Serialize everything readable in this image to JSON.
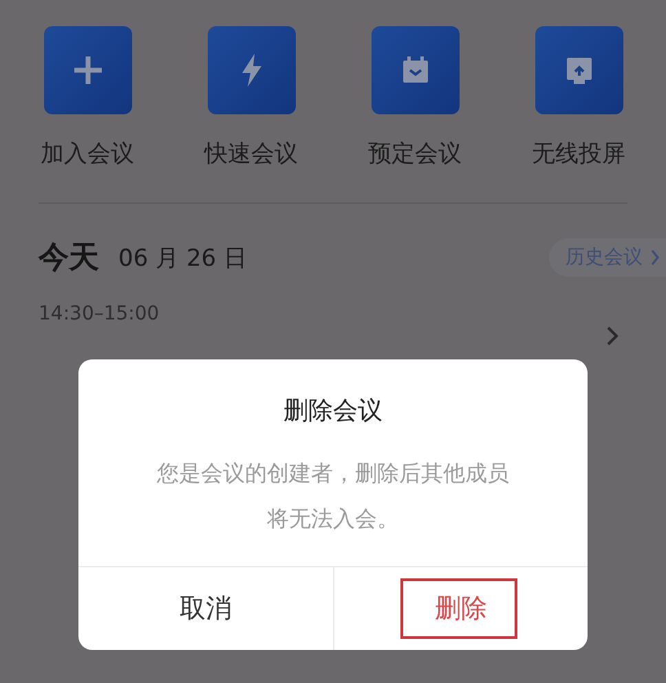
{
  "actions": [
    {
      "label": "加入会议",
      "kind": "plus"
    },
    {
      "label": "快速会议",
      "kind": "bolt"
    },
    {
      "label": "预定会议",
      "kind": "calendar"
    },
    {
      "label": "无线投屏",
      "kind": "cast"
    }
  ],
  "today": {
    "heading": "今天",
    "date": "06 月 26 日"
  },
  "history_button": "历史会议",
  "meeting": {
    "time": "14:30–15:00"
  },
  "dialog": {
    "title": "删除会议",
    "message": "您是会议的创建者，删除后其他成员将无法入会。",
    "buttons": [
      {
        "label": "取消",
        "kind": "cancel",
        "highlighted": false
      },
      {
        "label": "删除",
        "kind": "danger",
        "highlighted": true
      }
    ]
  }
}
